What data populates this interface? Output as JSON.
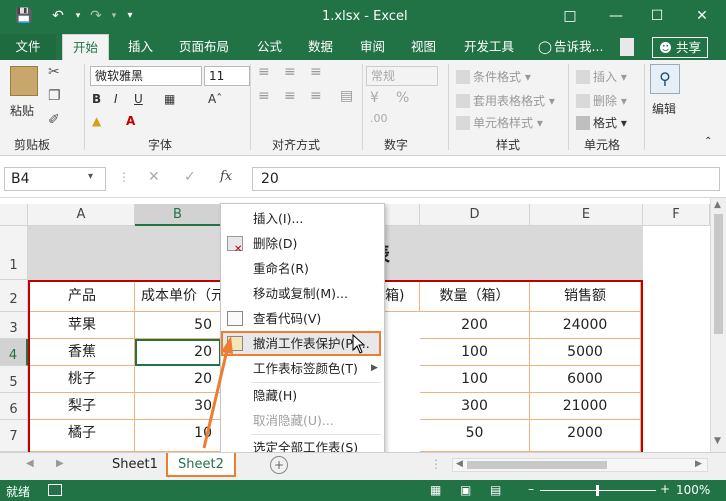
{
  "window": {
    "title": "1.xlsx - Excel"
  },
  "tabs": {
    "file": "文件",
    "home": "开始",
    "insert": "插入",
    "layout": "页面布局",
    "formulas": "公式",
    "data": "数据",
    "review": "审阅",
    "view": "视图",
    "developer": "开发工具",
    "tellme": "告诉我...",
    "share": "共享"
  },
  "ribbon": {
    "paste": "粘贴",
    "clipboard": "剪贴板",
    "font_name": "微软雅黑",
    "font_size": "11",
    "font": "字体",
    "alignment": "对齐方式",
    "number_format": "常规",
    "number": "数字",
    "cond_format": "条件格式",
    "table_format": "套用表格格式",
    "cell_style": "单元格样式",
    "styles": "样式",
    "insert": "插入",
    "delete": "删除",
    "format": "格式",
    "cells": "单元格",
    "edit": "编辑"
  },
  "formula_bar": {
    "name_box": "B4",
    "fx": "fx",
    "value": "20"
  },
  "columns": [
    "A",
    "B",
    "C",
    "D",
    "E",
    "F"
  ],
  "rows": [
    "1",
    "2",
    "3",
    "4",
    "5",
    "6",
    "7"
  ],
  "sheet": {
    "title_partial": "表",
    "headers": [
      "产品",
      "成本单价（元",
      "箱)",
      "数量（箱）",
      "销售额"
    ],
    "data": [
      [
        "苹果",
        "50",
        "200",
        "24000"
      ],
      [
        "香蕉",
        "20",
        "100",
        "5000"
      ],
      [
        "桃子",
        "20",
        "100",
        "6000"
      ],
      [
        "梨子",
        "30",
        "300",
        "21000"
      ],
      [
        "橘子",
        "10",
        "50",
        "2000"
      ]
    ]
  },
  "context_menu": {
    "items": [
      "插入(I)...",
      "删除(D)",
      "重命名(R)",
      "移动或复制(M)...",
      "查看代码(V)",
      "撤消工作表保护(P)...",
      "工作表标签颜色(T)",
      "隐藏(H)",
      "取消隐藏(U)...",
      "选定全部工作表(S)"
    ]
  },
  "sheet_tabs": [
    "Sheet1",
    "Sheet2"
  ],
  "status": {
    "ready": "就绪",
    "zoom": "100%"
  },
  "colors": {
    "excel_green": "#217346",
    "highlight": "#ed7d31",
    "table_border": "#c00000"
  }
}
